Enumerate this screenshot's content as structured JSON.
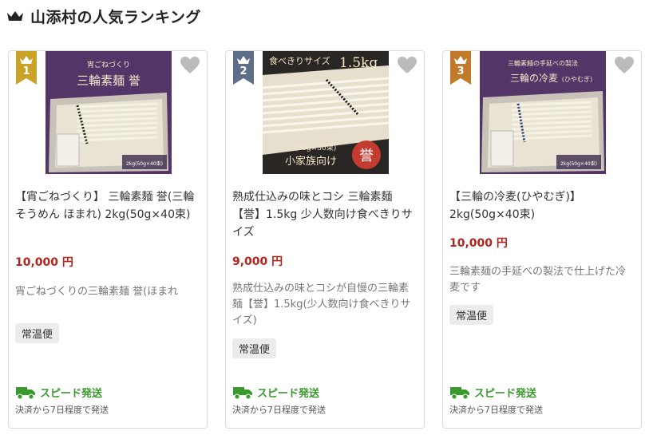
{
  "header": {
    "title": "山添村の人気ランキング"
  },
  "colors": {
    "rank1": "#c9a227",
    "rank2": "#5d6f88",
    "rank3": "#c07a2a",
    "price": "#b3241e",
    "ship": "#3a9b2d"
  },
  "products": [
    {
      "rank": "1",
      "image_text": {
        "line1": "宵ごねづくり",
        "line2": "三輪素麺 誉",
        "line3": "2kg(50g×40束)"
      },
      "name": "【宵ごねづくり】 三輪素麺 誉(三輪そうめん ほまれ) 2kg(50g×40束)",
      "price": "10,000 円",
      "desc": "宵ごねづくりの三輪素麺 誉(ほまれ",
      "tag": "常温便",
      "shipping": "スピード発送",
      "shipping_note": "決済から7日程度で発送"
    },
    {
      "rank": "2",
      "image_text": {
        "line1": "食べきりサイズ",
        "line2": "1.5kg",
        "line3": "(50g×30束)",
        "line4": "小家族向け",
        "seal": "誉"
      },
      "name": "熟成仕込みの味とコシ 三輪素麺【誉】1.5kg 少人数向け食べきりサイズ",
      "price": "9,000 円",
      "desc": "熟成仕込みの味とコシが自慢の三輪素麺【誉】1.5kg(少人数向け食べきりサイズ)",
      "tag": "常温便",
      "shipping": "スピード発送",
      "shipping_note": "決済から7日程度で発送"
    },
    {
      "rank": "3",
      "image_text": {
        "line1": "三輪素麺の手延べの製法",
        "line2": "三輪の冷麦",
        "line3": "(ひやむぎ)",
        "line4": "2kg(50g×40束)"
      },
      "name": "【三輪の冷麦(ひやむぎ)】2kg(50g×40束)",
      "price": "10,000 円",
      "desc": "三輪素麺の手延べの製法で仕上げた冷麦です",
      "tag": "常温便",
      "shipping": "スピード発送",
      "shipping_note": "決済から7日程度で発送"
    }
  ]
}
